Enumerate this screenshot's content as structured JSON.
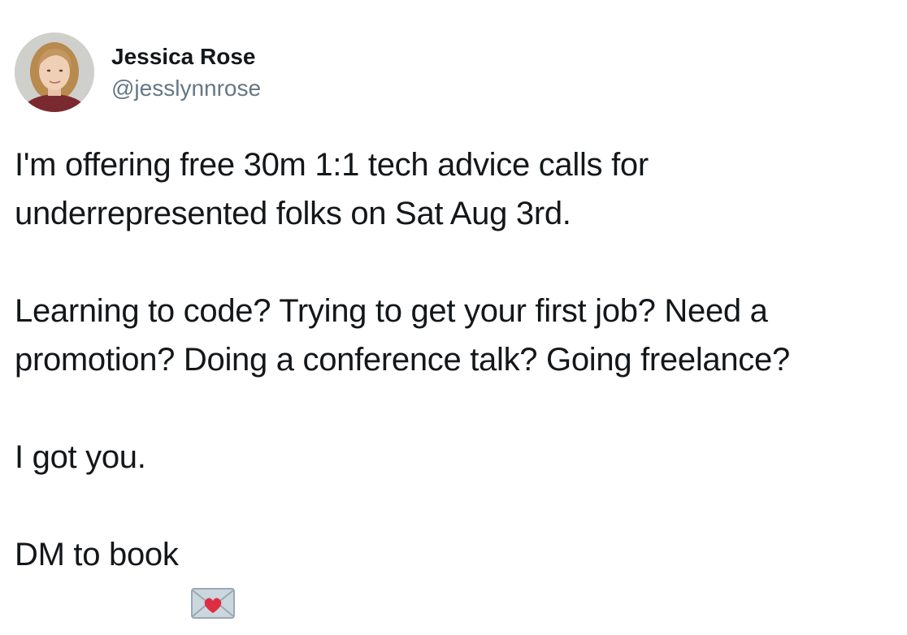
{
  "tweet": {
    "author": {
      "display_name": "Jessica Rose",
      "handle": "@jesslynnrose",
      "avatar_icon": "avatar-photo"
    },
    "paragraphs": [
      "I'm offering free 30m 1:1 tech advice calls for\nunderrepresented folks on Sat Aug 3rd.",
      "Learning to code? Trying to get your first job? Need a\npromotion? Doing a conference talk? Going freelance?",
      "I got you."
    ],
    "closing_text": "DM to book",
    "closing_emoji": "love-letter-envelope-icon"
  },
  "colors": {
    "text": "#14171a",
    "handle": "#657786",
    "heart": "#dd2e44",
    "background": "#ffffff"
  }
}
